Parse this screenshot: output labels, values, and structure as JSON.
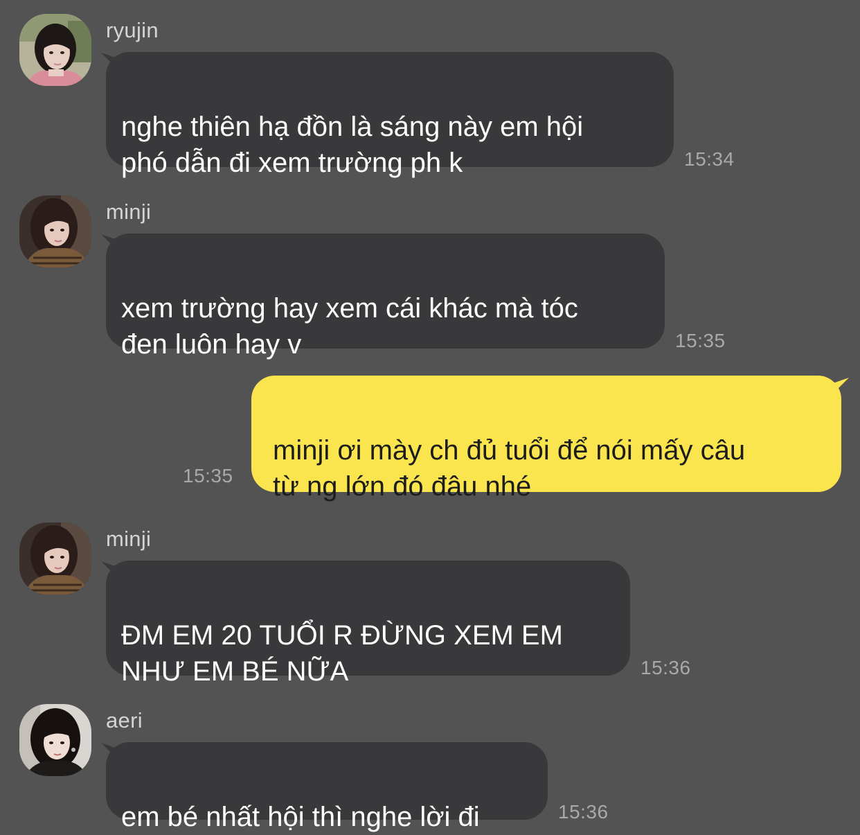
{
  "chat": {
    "messages": [
      {
        "sender": "ryujin",
        "avatar_icon": "ryujin-avatar",
        "text": "nghe thiên hạ đồn là sáng này em hội\nphó dẫn đi xem trường ph k",
        "time": "15:34",
        "direction": "incoming"
      },
      {
        "sender": "minji",
        "avatar_icon": "minji-avatar",
        "text": "xem trường hay xem cái khác mà tóc\nđen luôn hay v",
        "time": "15:35",
        "direction": "incoming"
      },
      {
        "sender": "",
        "text": "minji ơi mày ch đủ tuổi để nói mấy câu\ntừ ng lớn đó đâu nhé",
        "time": "15:35",
        "direction": "outgoing"
      },
      {
        "sender": "minji",
        "avatar_icon": "minji-avatar",
        "text": "ĐM EM 20 TUỔI R ĐỪNG XEM EM\nNHƯ EM BÉ NỮA",
        "time": "15:36",
        "direction": "incoming"
      },
      {
        "sender": "aeri",
        "avatar_icon": "aeri-avatar",
        "text": "em bé nhất hội thì nghe lời đi",
        "time": "15:36",
        "direction": "incoming"
      }
    ]
  },
  "colors": {
    "background": "#545354",
    "incoming_bubble": "#39383b",
    "outgoing_bubble": "#fbe54e"
  }
}
